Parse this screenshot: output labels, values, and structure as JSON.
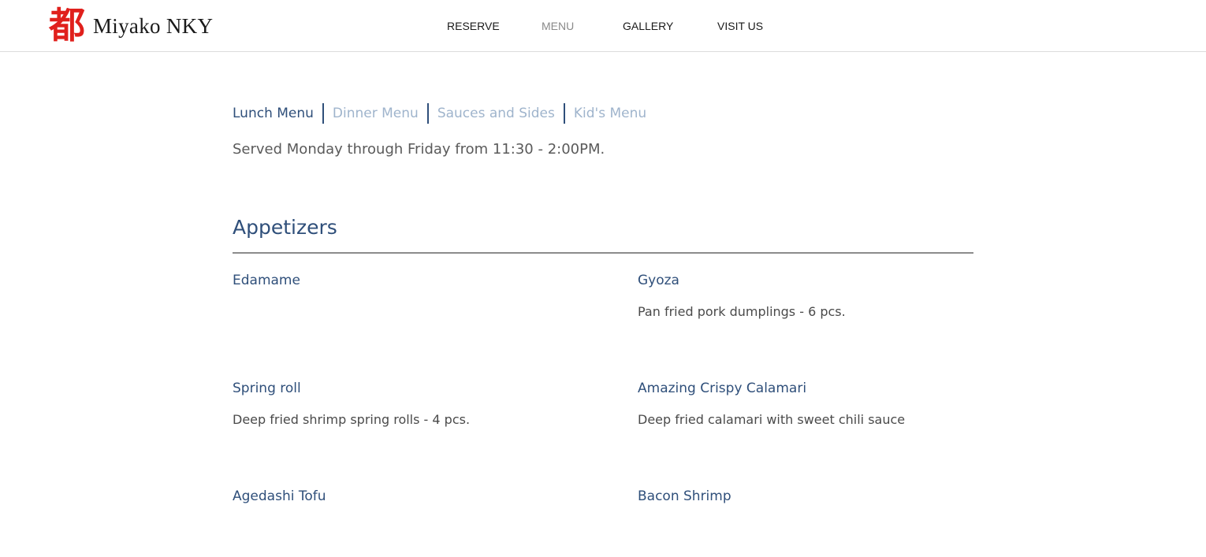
{
  "header": {
    "logo_glyph": "都",
    "brand": "Miyako NKY",
    "nav": [
      {
        "label": "RESERVE"
      },
      {
        "label": "MENU"
      },
      {
        "label": "GALLERY"
      },
      {
        "label": "VISIT US"
      }
    ],
    "active_nav": "MENU"
  },
  "menu": {
    "tabs": [
      {
        "label": "Lunch Menu"
      },
      {
        "label": "Dinner Menu"
      },
      {
        "label": "Sauces and Sides"
      },
      {
        "label": "Kid's Menu"
      }
    ],
    "active_tab": "Lunch Menu",
    "served_note": "Served Monday through Friday from 11:30 - 2:00PM.",
    "section_title": "Appetizers",
    "items": [
      {
        "name": "Edamame",
        "description": ""
      },
      {
        "name": "Gyoza",
        "description": "Pan fried pork dumplings - 6 pcs."
      },
      {
        "name": "Spring roll",
        "description": "Deep fried shrimp spring rolls - 4 pcs."
      },
      {
        "name": "Amazing Crispy Calamari",
        "description": "Deep fried calamari with sweet chili sauce"
      },
      {
        "name": "Agedashi Tofu",
        "description": ""
      },
      {
        "name": "Bacon Shrimp",
        "description": ""
      }
    ]
  },
  "colors": {
    "logo_red": "#e0201c",
    "accent_navy": "#2f4f7a",
    "inactive_tab": "#9fb4cc",
    "body_text": "#4a4a4a"
  }
}
